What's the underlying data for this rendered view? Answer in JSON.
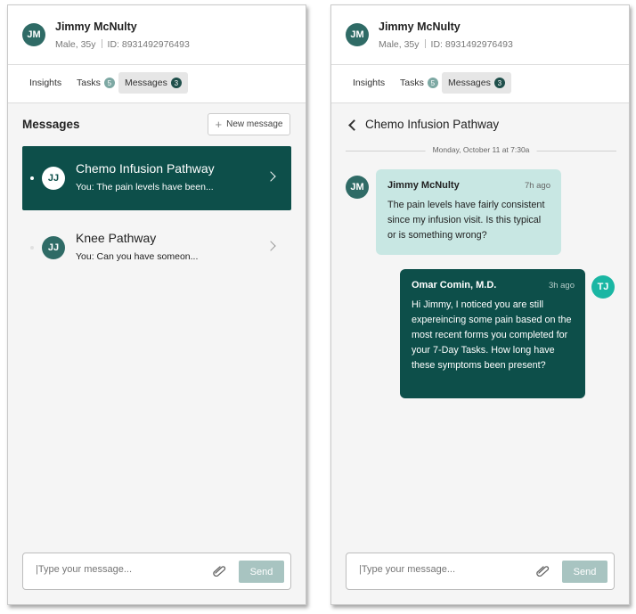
{
  "patient": {
    "initials": "JM",
    "name": "Jimmy McNulty",
    "demographics": "Male, 35y",
    "id_text": "ID: 8931492976493"
  },
  "tabs": [
    {
      "label": "Insights"
    },
    {
      "label": "Tasks",
      "badge": "5"
    },
    {
      "label": "Messages",
      "badge": "3",
      "active": true
    }
  ],
  "messages_list": {
    "title": "Messages",
    "new_button_label": "New message",
    "conversations": [
      {
        "initials": "JJ",
        "title": "Chemo Infusion Pathway",
        "preview": "You: The pain levels have been...",
        "selected": true
      },
      {
        "initials": "JJ",
        "title": "Knee Pathway",
        "preview": "You: Can you have someon...",
        "selected": false
      }
    ]
  },
  "thread": {
    "title": "Chemo Infusion Pathway",
    "date_divider": "Monday, October 11 at 7:30a",
    "messages": [
      {
        "initials": "JM",
        "sender": "Jimmy McNulty",
        "time": "7h ago",
        "text": "The pain levels have fairly consistent since my infusion visit. Is this typical or is something wrong?",
        "direction": "incoming"
      },
      {
        "initials": "TJ",
        "sender": "Omar Comin, M.D.",
        "time": "3h ago",
        "text": "Hi Jimmy,  I noticed you are still expereincing some pain based on the most recent forms you completed for your 7-Day Tasks. How long have these symptoms been present?",
        "direction": "outgoing"
      }
    ]
  },
  "composer": {
    "placeholder": "|Type your message...",
    "send_label": "Send"
  },
  "icons": {
    "back": "chevron-left-icon",
    "open_conversation": "chevron-right-icon",
    "attach": "paperclip-icon",
    "add": "plus-icon"
  },
  "colors": {
    "primary": "#0d4f4a",
    "avatar": "#2f6b66",
    "incoming_bubble": "#c8e7e3",
    "send_disabled": "#a8c4c1",
    "tj_avatar": "#1ab6a3"
  }
}
